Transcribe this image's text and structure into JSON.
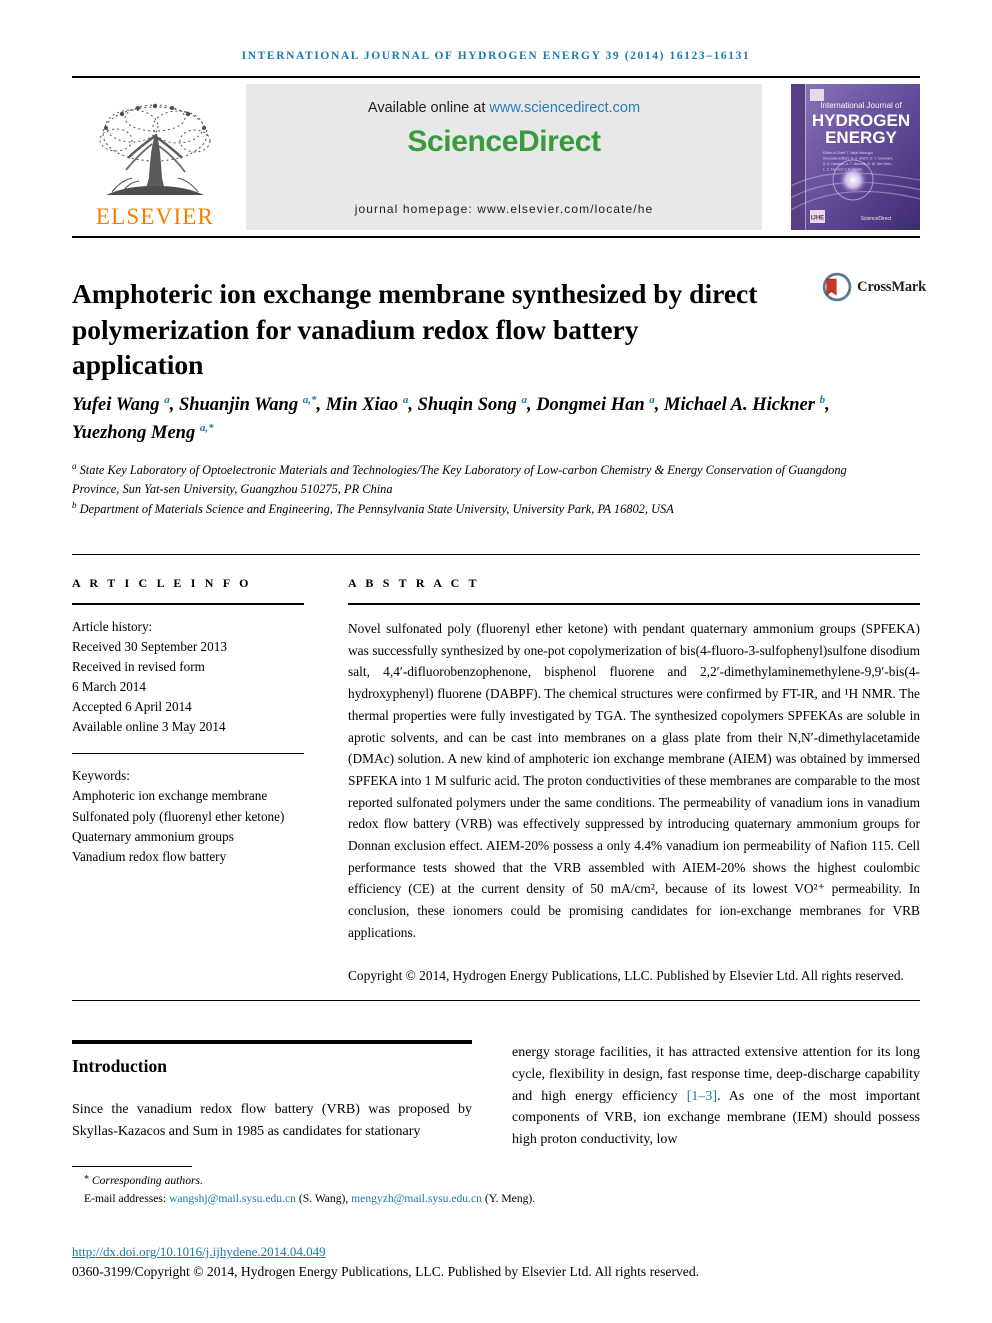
{
  "running_head": "International Journal of Hydrogen Energy 39 (2014) 16123–16131",
  "masthead": {
    "publisher_name": "ELSEVIER",
    "publisher_logo_icon": "elsevier-tree-icon",
    "available_prefix": "Available online at ",
    "available_url": "www.sciencedirect.com",
    "sciencedirect_logo": "ScienceDirect",
    "journal_homepage": "journal homepage: www.elsevier.com/locate/he",
    "cover": {
      "line1": "International Journal of",
      "line2": "HYDROGEN",
      "line3": "ENERGY",
      "editor_line1": "Editor-in-Chief: T. Nejat Veziroglu",
      "editor_line2": "Associate Editors: S. A. Sherif, D. Y. Goswami, S. A. Gamboa,",
      "editor_line3": "A. T. Marolda, D. W. Der Vries,",
      "editor_line4": "L. Z. Fan and T. O. Saetre",
      "footer_brand": "ScienceDirect",
      "corner_logo": "IJHE"
    }
  },
  "article": {
    "title": "Amphoteric ion exchange membrane synthesized by direct polymerization for vanadium redox flow battery application",
    "crossmark_label": "CrossMark",
    "authors_html": "Yufei Wang <sup>a</sup>, Shuanjin Wang <sup>a,*</sup>, Min Xiao <sup>a</sup>, Shuqin Song <sup>a</sup>, Dongmei Han <sup>a</sup>, Michael A. Hickner <sup>b</sup>, Yuezhong Meng <sup>a,*</sup>",
    "affiliation_a": "State Key Laboratory of Optoelectronic Materials and Technologies/The Key Laboratory of Low-carbon Chemistry & Energy Conservation of Guangdong Province, Sun Yat-sen University, Guangzhou 510275, PR China",
    "affiliation_b": "Department of Materials Science and Engineering, The Pennsylvania State University, University Park, PA 16802, USA"
  },
  "article_info": {
    "heading": "A R T I C L E   I N F O",
    "history_label": "Article history:",
    "history": [
      "Received 30 September 2013",
      "Received in revised form",
      "6 March 2014",
      "Accepted 6 April 2014",
      "Available online 3 May 2014"
    ],
    "keywords_label": "Keywords:",
    "keywords": [
      "Amphoteric ion exchange membrane",
      "Sulfonated poly (fluorenyl ether ketone)",
      "Quaternary ammonium groups",
      "Vanadium redox flow battery"
    ]
  },
  "abstract": {
    "heading": "A B S T R A C T",
    "body": "Novel sulfonated poly (fluorenyl ether ketone) with pendant quaternary ammonium groups (SPFEKA) was successfully synthesized by one-pot copolymerization of bis(4-fluoro-3-sulfophenyl)sulfone disodium salt, 4,4′-difluorobenzophenone, bisphenol fluorene and 2,2′-dimethylaminemethylene-9,9′-bis(4-hydroxyphenyl) fluorene (DABPF). The chemical structures were confirmed by FT-IR, and ¹H NMR. The thermal properties were fully investigated by TGA. The synthesized copolymers SPFEKAs are soluble in aprotic solvents, and can be cast into membranes on a glass plate from their N,N′-dimethylacetamide (DMAc) solution. A new kind of amphoteric ion exchange membrane (AIEM) was obtained by immersed SPFEKA into 1 M sulfuric acid. The proton conductivities of these membranes are comparable to the most reported sulfonated polymers under the same conditions. The permeability of vanadium ions in vanadium redox flow battery (VRB) was effectively suppressed by introducing quaternary ammonium groups for Donnan exclusion effect. AIEM-20% possess a only 4.4% vanadium ion permeability of Nafion 115. Cell performance tests showed that the VRB assembled with AIEM-20% shows the highest coulombic efficiency (CE) at the current density of 50 mA/cm², because of its lowest VO²⁺ permeability. In conclusion, these ionomers could be promising candidates for ion-exchange membranes for VRB applications.",
    "copyright": "Copyright © 2014, Hydrogen Energy Publications, LLC. Published by Elsevier Ltd. All rights reserved."
  },
  "introduction": {
    "heading": "Introduction",
    "col_left": "Since the vanadium redox flow battery (VRB) was proposed by Skyllas-Kazacos and Sum in 1985 as candidates for stationary",
    "col_right_part1": "energy storage facilities, it has attracted extensive attention for its long cycle, flexibility in design, fast response time, deep-discharge capability and high energy efficiency ",
    "col_right_citation": "[1–3]",
    "col_right_part2": ". As one of the most important components of VRB, ion exchange membrane (IEM) should possess high proton conductivity, low"
  },
  "footer": {
    "corresponding_label": "Corresponding authors.",
    "email_label": "E-mail addresses:",
    "email1": "wangshj@mail.sysu.edu.cn",
    "email1_owner": "(S. Wang)",
    "email2": "mengyzh@mail.sysu.edu.cn",
    "email2_owner": "(Y. Meng).",
    "doi": "http://dx.doi.org/10.1016/j.ijhydene.2014.04.049",
    "copyright_line": "0360-3199/Copyright © 2014, Hydrogen Energy Publications, LLC. Published by Elsevier Ltd. All rights reserved."
  },
  "colors": {
    "journal_blue": "#1a7aad",
    "sciencedirect_green": "#3a9b3c",
    "link_blue": "#2b7bb9",
    "elsevier_orange": "#f08000",
    "crossmark_red": "#c8362a"
  }
}
